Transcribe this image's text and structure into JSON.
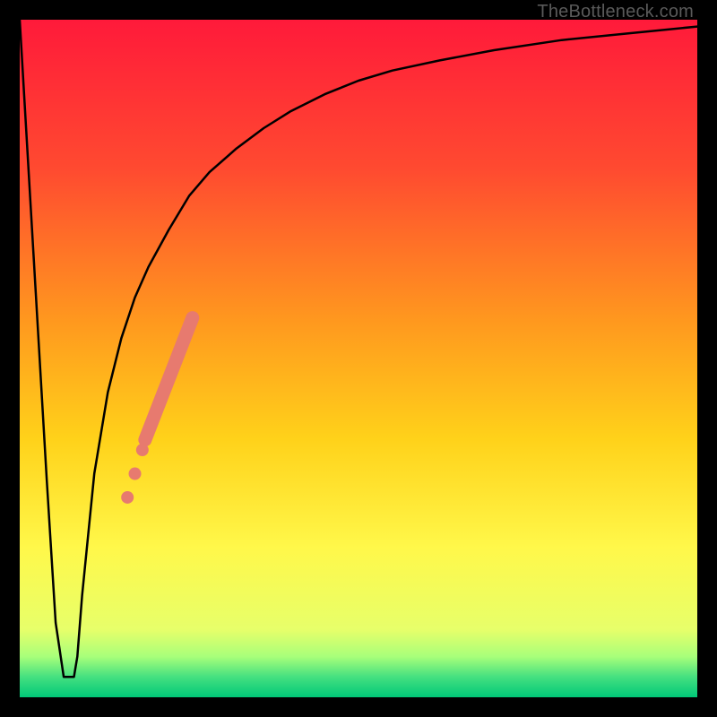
{
  "watermark": "TheBottleneck.com",
  "chart_data": {
    "type": "line",
    "title": "",
    "xlabel": "",
    "ylabel": "",
    "xlim": [
      0,
      100
    ],
    "ylim": [
      0,
      100
    ],
    "grid": false,
    "legend": false,
    "background_gradient": {
      "stops": [
        {
          "offset": 0.0,
          "color": "#ff1a3a"
        },
        {
          "offset": 0.22,
          "color": "#ff4a30"
        },
        {
          "offset": 0.45,
          "color": "#ff9a1e"
        },
        {
          "offset": 0.62,
          "color": "#ffd21a"
        },
        {
          "offset": 0.78,
          "color": "#fff84a"
        },
        {
          "offset": 0.9,
          "color": "#e7ff6a"
        },
        {
          "offset": 0.94,
          "color": "#a8ff7a"
        },
        {
          "offset": 0.97,
          "color": "#45e080"
        },
        {
          "offset": 1.0,
          "color": "#00c878"
        }
      ]
    },
    "series": [
      {
        "name": "curve",
        "stroke": "#000000",
        "stroke_width": 2.5,
        "x": [
          0,
          2,
          4,
          5.3,
          6.5,
          7.5,
          8,
          8.5,
          9.2,
          11,
          13,
          15,
          17,
          19,
          22,
          25,
          28,
          32,
          36,
          40,
          45,
          50,
          55,
          62,
          70,
          80,
          90,
          100
        ],
        "y": [
          100,
          66,
          32,
          11,
          3,
          3,
          3,
          6,
          15,
          33,
          45,
          53,
          59,
          63.5,
          69,
          74,
          77.5,
          81,
          84,
          86.5,
          89,
          91,
          92.5,
          94,
          95.5,
          97,
          98,
          99
        ]
      }
    ],
    "highlight_segment": {
      "color": "#e77a6f",
      "thick_width": 15,
      "x": [
        18.5,
        25.5
      ],
      "y": [
        38,
        56
      ]
    },
    "highlight_dots": {
      "color": "#e77a6f",
      "radius": 7,
      "points": [
        {
          "x": 18.1,
          "y": 36.5
        },
        {
          "x": 17.0,
          "y": 33.0
        },
        {
          "x": 15.9,
          "y": 29.5
        }
      ]
    }
  }
}
